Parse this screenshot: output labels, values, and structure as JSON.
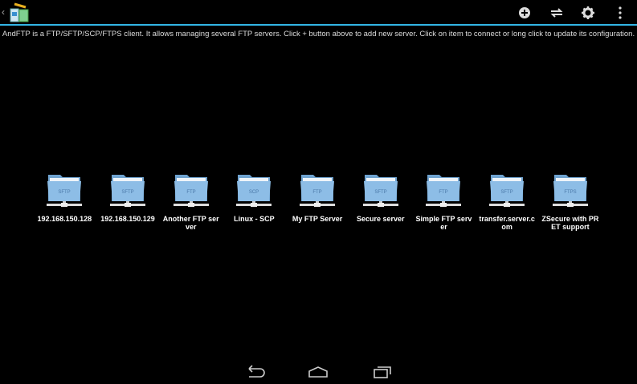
{
  "app": {
    "name": "AndFTP"
  },
  "actions": {
    "add": "add-icon",
    "transfer": "transfer-icon",
    "settings": "gear-icon",
    "overflow": "overflow-icon"
  },
  "description": "AndFTP is a FTP/SFTP/SCP/FTPS client. It allows managing several FTP servers. Click + button above to add new server. Click on item to connect or long click to update its configuration.",
  "servers": [
    {
      "name": "192.168.150.128",
      "type": "SFTP"
    },
    {
      "name": "192.168.150.129",
      "type": "SFTP"
    },
    {
      "name": "Another FTP server",
      "type": "FTP"
    },
    {
      "name": "Linux - SCP",
      "type": "SCP"
    },
    {
      "name": "My FTP Server",
      "type": "FTP"
    },
    {
      "name": "Secure server",
      "type": "SFTP"
    },
    {
      "name": "Simple FTP server",
      "type": "FTP"
    },
    {
      "name": "transfer.server.com",
      "type": "SFTP"
    },
    {
      "name": "ZSecure with PRET support",
      "type": "FTPS"
    }
  ],
  "colors": {
    "accent": "#33b5e5",
    "folder": "#8dbde6"
  }
}
